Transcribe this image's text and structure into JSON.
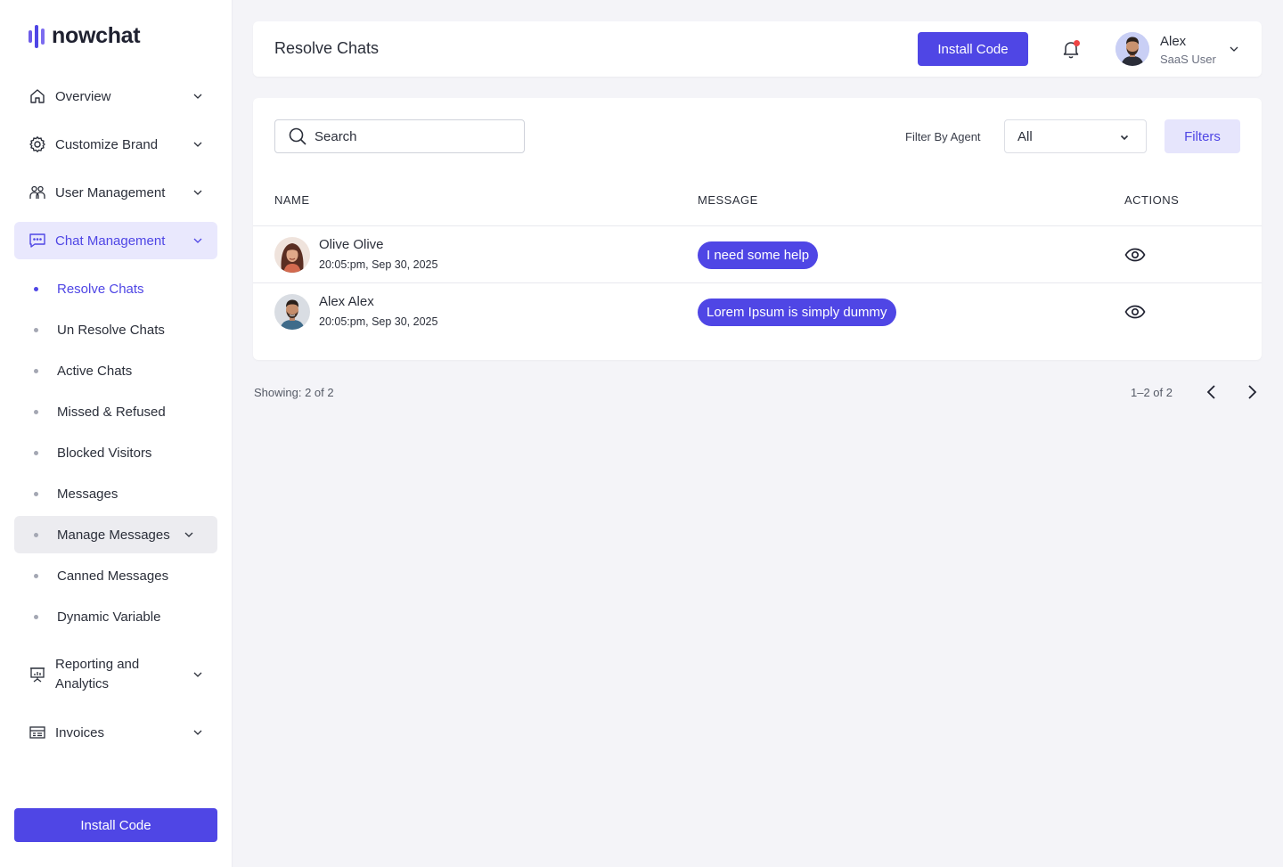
{
  "brand": {
    "name": "nowchat"
  },
  "sidebar": {
    "items": [
      {
        "label": "Overview",
        "icon": "home-icon"
      },
      {
        "label": "Customize Brand",
        "icon": "gear-icon"
      },
      {
        "label": "User Management",
        "icon": "users-icon"
      },
      {
        "label": "Chat Management",
        "icon": "chat-icon",
        "active": true
      },
      {
        "label": "Reporting and Analytics",
        "icon": "presentation-chart-icon"
      },
      {
        "label": "Invoices",
        "icon": "invoice-icon"
      }
    ],
    "chat_sub": [
      {
        "label": "Resolve Chats",
        "active": true
      },
      {
        "label": "Un Resolve Chats"
      },
      {
        "label": "Active Chats"
      },
      {
        "label": "Missed & Refused"
      },
      {
        "label": "Blocked Visitors"
      },
      {
        "label": "Messages"
      },
      {
        "label": "Manage Messages",
        "group": true
      },
      {
        "label": "Canned Messages"
      },
      {
        "label": "Dynamic Variable"
      }
    ],
    "install_label": "Install Code"
  },
  "header": {
    "title": "Resolve Chats",
    "install_label": "Install Code",
    "user": {
      "name": "Alex",
      "role": "SaaS User"
    }
  },
  "toolbar": {
    "search_placeholder": "Search",
    "filter_label": "Filter By Agent",
    "agent_selected": "All",
    "filters_label": "Filters"
  },
  "table": {
    "columns": [
      "NAME",
      "MESSAGE",
      "ACTIONS"
    ],
    "rows": [
      {
        "name": "Olive Olive",
        "time": "20:05:pm, Sep 30, 2025",
        "message": "I need some help"
      },
      {
        "name": "Alex Alex",
        "time": "20:05:pm, Sep 30, 2025",
        "message": "Lorem Ipsum is simply dummy"
      }
    ]
  },
  "pagination": {
    "showing": "Showing: 2 of 2",
    "range": "1–2 of 2"
  },
  "colors": {
    "accent": "#4f46e5",
    "accent_light": "#e9e8fd",
    "notification": "#ef4444"
  }
}
